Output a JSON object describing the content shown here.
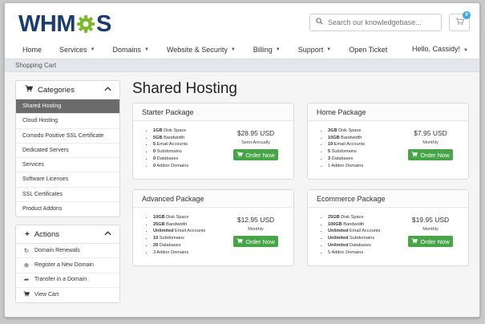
{
  "brand": {
    "logo_left": "WHM",
    "logo_right": "S",
    "colors": {
      "navy": "#1a3c6e",
      "green": "#7ab929",
      "button_green": "#47a447",
      "badge_blue": "#3ea8e0"
    }
  },
  "search": {
    "placeholder": "Search our knowledgebase...",
    "icon": "search-icon"
  },
  "cart": {
    "count": "0",
    "icon": "cart-icon"
  },
  "nav": {
    "items": [
      {
        "label": "Home",
        "caret": false
      },
      {
        "label": "Services",
        "caret": true
      },
      {
        "label": "Domains",
        "caret": true
      },
      {
        "label": "Website & Security",
        "caret": true
      },
      {
        "label": "Billing",
        "caret": true
      },
      {
        "label": "Support",
        "caret": true
      },
      {
        "label": "Open Ticket",
        "caret": false
      }
    ],
    "user": "Hello, Cassidy!"
  },
  "breadcrumb": "Shopping Cart",
  "sidebar": {
    "categories_title": "Categories",
    "categories": [
      "Shared Hosting",
      "Cloud Hosting",
      "Comodo Positive SSL Certificate",
      "Dedicated Servers",
      "Services",
      "Software Licenses",
      "SSL Certificates",
      "Product Addons"
    ],
    "actions_title": "Actions",
    "actions": [
      {
        "label": "Domain Renewals",
        "icon": "refresh-icon"
      },
      {
        "label": "Register a New Domain",
        "icon": "globe-icon"
      },
      {
        "label": "Transfer in a Domain",
        "icon": "share-icon"
      },
      {
        "label": "View Cart",
        "icon": "cart-icon"
      }
    ]
  },
  "page_title": "Shared Hosting",
  "order_label": "Order Now",
  "products": [
    {
      "name": "Starter Package",
      "price": "$28.95 USD",
      "cycle": "Semi-Annually",
      "features": [
        {
          "b": "1GB",
          "t": " Disk Space"
        },
        {
          "b": "5GB",
          "t": " Bandwidth"
        },
        {
          "b": "5",
          "t": " Email Accounts"
        },
        {
          "b": "0",
          "t": " Subdomains"
        },
        {
          "b": "0",
          "t": " Databases"
        },
        {
          "b": "0",
          "t": " Addon Domains"
        }
      ]
    },
    {
      "name": "Home Package",
      "price": "$7.95 USD",
      "cycle": "Monthly",
      "features": [
        {
          "b": "3GB",
          "t": " Disk Space"
        },
        {
          "b": "10GB",
          "t": " Bandwidth"
        },
        {
          "b": "10",
          "t": " Email Accounts"
        },
        {
          "b": "5",
          "t": " Subdomains"
        },
        {
          "b": "3",
          "t": " Databases"
        },
        {
          "b": "",
          "t": "1 Addon Domains"
        }
      ]
    },
    {
      "name": "Advanced Package",
      "price": "$12.95 USD",
      "cycle": "Monthly",
      "features": [
        {
          "b": "10GB",
          "t": " Disk Space"
        },
        {
          "b": "25GB",
          "t": " Bandwidth"
        },
        {
          "b": "Unlimited",
          "t": " Email Accounts"
        },
        {
          "b": "10",
          "t": " Subdomains"
        },
        {
          "b": "20",
          "t": " Databases"
        },
        {
          "b": "",
          "t": "3 Addon Domains"
        }
      ]
    },
    {
      "name": "Ecommerce Package",
      "price": "$19.95 USD",
      "cycle": "Monthly",
      "features": [
        {
          "b": "25GB",
          "t": " Disk Space"
        },
        {
          "b": "100GB",
          "t": " Bandwidth"
        },
        {
          "b": "Unlimited",
          "t": " Email Accounts"
        },
        {
          "b": "Unlimited",
          "t": " Subdomains"
        },
        {
          "b": "Unlimited",
          "t": " Databases"
        },
        {
          "b": "",
          "t": "5 Addon Domains"
        }
      ]
    }
  ]
}
